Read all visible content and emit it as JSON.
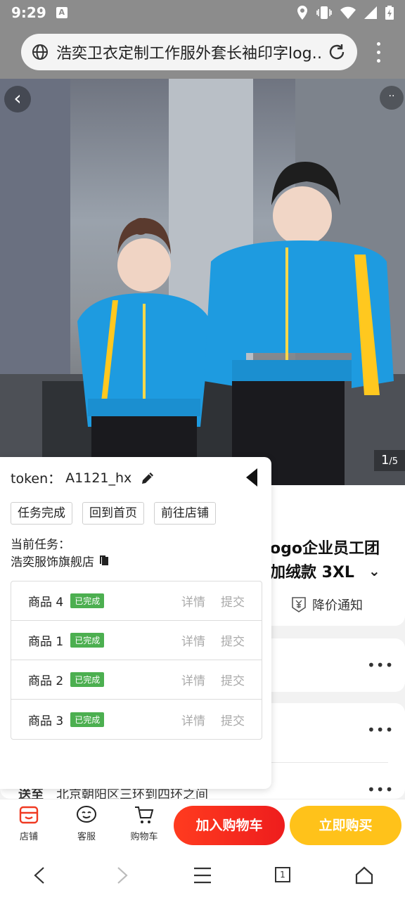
{
  "status_bar": {
    "time": "9:29",
    "a_badge": "A"
  },
  "browser": {
    "url_text": "浩奕卫衣定制工作服外套长袖印字log…",
    "icons": {
      "site": "globe-icon",
      "reload": "reload-icon",
      "menu": "overflow-menu-icon"
    }
  },
  "gallery": {
    "back_glyph": "‹",
    "more_glyph": "··",
    "index_current": "1",
    "index_total": "/5"
  },
  "product": {
    "title": "ogo企业员工团加绒款 3XL",
    "chevron": "⌄",
    "price_notify": "降价通知"
  },
  "rows": {
    "more_glyph": "•••",
    "deliver_label": "送至",
    "deliver_value": "北京朝阳区三环到四环之间"
  },
  "panel": {
    "token_label": "token：",
    "token_value": "A1121_hx",
    "buttons": [
      "任务完成",
      "回到首页",
      "前往店铺"
    ],
    "task_label": "当前任务：",
    "task_shop": "浩奕服饰旗舰店",
    "tasks": [
      {
        "name": "商品 4",
        "status": "已完成",
        "detail": "详情",
        "submit": "提交"
      },
      {
        "name": "商品 1",
        "status": "已完成",
        "detail": "详情",
        "submit": "提交"
      },
      {
        "name": "商品 2",
        "status": "已完成",
        "detail": "详情",
        "submit": "提交"
      },
      {
        "name": "商品 3",
        "status": "已完成",
        "detail": "详情",
        "submit": "提交"
      }
    ]
  },
  "action_bar": {
    "shop": "店铺",
    "service": "客服",
    "cart": "购物车",
    "add_to_cart": "加入购物车",
    "buy_now": "立即购买"
  },
  "system_nav": {
    "tab_count": "1"
  },
  "colors": {
    "accent_red": "#ee1d1d",
    "accent_yellow": "#ffc21a",
    "done_green": "#4caf50",
    "jacket_blue": "#1e9be0"
  }
}
